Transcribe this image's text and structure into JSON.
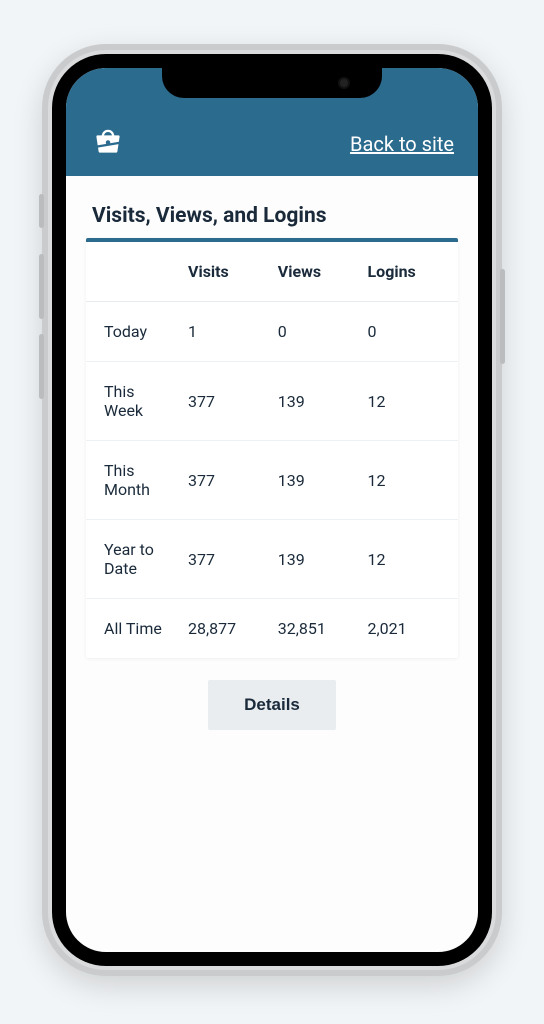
{
  "header": {
    "back_label": "Back to site"
  },
  "card": {
    "title": "Visits, Views, and Logins",
    "columns": {
      "period": "",
      "visits": "Visits",
      "views": "Views",
      "logins": "Logins"
    },
    "rows": [
      {
        "period": "Today",
        "visits": "1",
        "views": "0",
        "logins": "0"
      },
      {
        "period": "This Week",
        "visits": "377",
        "views": "139",
        "logins": "12"
      },
      {
        "period": "This Month",
        "visits": "377",
        "views": "139",
        "logins": "12"
      },
      {
        "period": "Year to Date",
        "visits": "377",
        "views": "139",
        "logins": "12"
      },
      {
        "period": "All Time",
        "visits": "28,877",
        "views": "32,851",
        "logins": "2,021"
      }
    ],
    "details_label": "Details"
  }
}
